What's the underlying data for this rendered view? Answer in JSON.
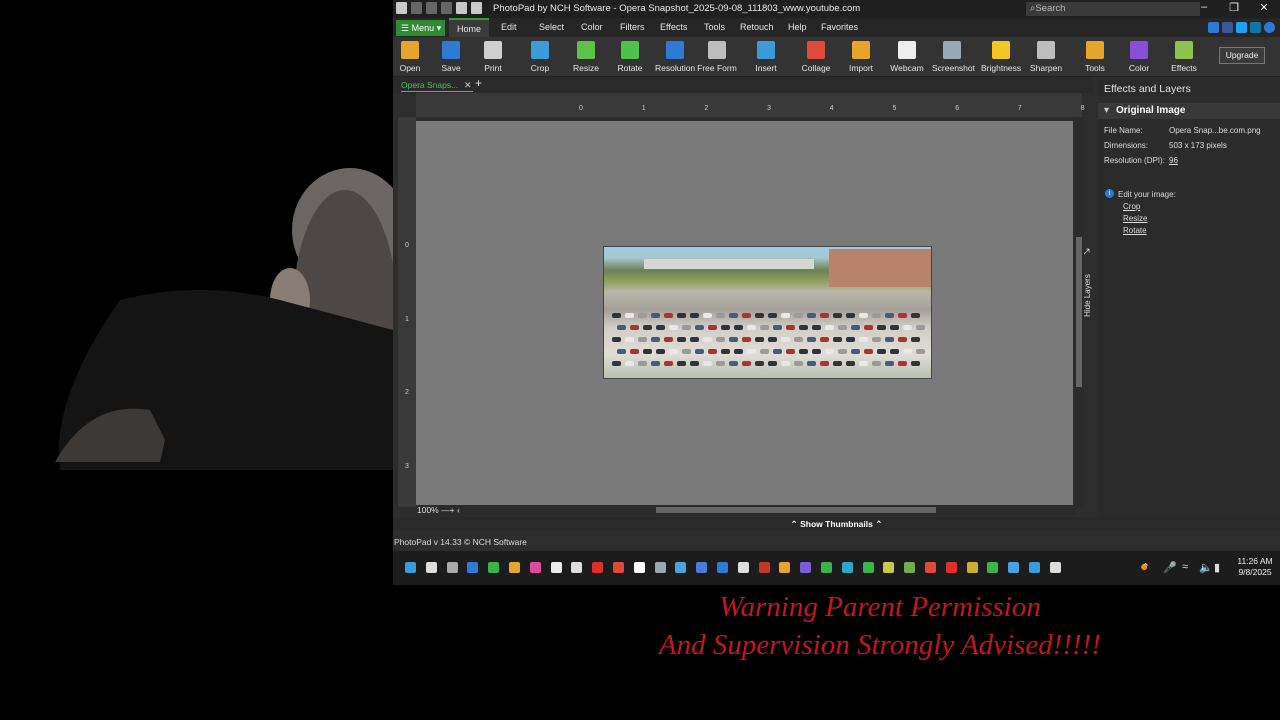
{
  "window": {
    "title": "PhotoPad by NCH Software - Opera Snapshot_2025-09-08_111803_www.youtube.com",
    "search_placeholder": "Search"
  },
  "menu": {
    "menu_button": "Menu",
    "items": [
      "Home",
      "Edit",
      "Select",
      "Color",
      "Filters",
      "Effects",
      "Tools",
      "Retouch",
      "Help",
      "Favorites"
    ]
  },
  "ribbon": {
    "buttons": [
      {
        "label": "Open",
        "icon": "folder-icon",
        "color": "#e5a52b"
      },
      {
        "label": "Save",
        "icon": "save-icon",
        "color": "#2e7bd6"
      },
      {
        "label": "Print",
        "icon": "printer-icon",
        "color": "#cfcfcf"
      },
      {
        "label": "Crop",
        "icon": "crop-icon",
        "color": "#3b9bd8"
      },
      {
        "label": "Resize",
        "icon": "resize-icon",
        "color": "#5cc24a"
      },
      {
        "label": "Rotate",
        "icon": "rotate-icon",
        "color": "#4cc24a"
      },
      {
        "label": "Resolution",
        "icon": "resolution-icon",
        "color": "#2e7bd6"
      },
      {
        "label": "Free Form",
        "icon": "freeform-icon",
        "color": "#bdbdbd"
      },
      {
        "label": "Insert",
        "icon": "insert-icon",
        "color": "#3b9bd8"
      },
      {
        "label": "Collage",
        "icon": "collage-icon",
        "color": "#e04a3a"
      },
      {
        "label": "Import",
        "icon": "import-icon",
        "color": "#e5a52b"
      },
      {
        "label": "Webcam",
        "icon": "webcam-icon",
        "color": "#eeeeee"
      },
      {
        "label": "Screenshot",
        "icon": "screenshot-icon",
        "color": "#9aa7b5"
      },
      {
        "label": "Brightness",
        "icon": "brightness-icon",
        "color": "#f3c623"
      },
      {
        "label": "Sharpen",
        "icon": "sharpen-icon",
        "color": "#bdbdbd"
      },
      {
        "label": "Tools",
        "icon": "tools-icon",
        "color": "#e5a52b"
      },
      {
        "label": "Color",
        "icon": "color-icon",
        "color": "#8a4fd8"
      },
      {
        "label": "Effects",
        "icon": "effects-icon",
        "color": "#8fc24a"
      }
    ],
    "upgrade": "Upgrade"
  },
  "document_tab": "Opera Snaps...",
  "ruler": {
    "top": [
      "0",
      "1",
      "2",
      "3",
      "4",
      "5",
      "6",
      "7",
      "8"
    ],
    "left": [
      "0",
      "1",
      "2",
      "3"
    ]
  },
  "zoom_level": "100%",
  "side_tab": "Hide Layers",
  "panel": {
    "title": "Effects and Layers",
    "section": "Original Image",
    "file_name_label": "File Name:",
    "file_name": "Opera Snap...be.com.png",
    "dimensions_label": "Dimensions:",
    "dimensions": "503 x 173 pixels",
    "resolution_label": "Resolution (DPI):",
    "resolution": "96",
    "edit_label": "Edit your image:",
    "links": [
      "Crop",
      "Resize",
      "Rotate"
    ]
  },
  "thumbnails_toggle": "Show Thumbnails",
  "status": "PhotoPad v 14.33 © NCH Software",
  "taskbar": {
    "time": "11:26 AM",
    "date": "9/8/2025"
  },
  "overlay": {
    "line1": "Warning Parent Permission",
    "line2": "And Supervision Strongly Advised!!!!!"
  },
  "colors": {
    "accent_green": "#2f8a34",
    "warning_red": "#c8141e"
  }
}
